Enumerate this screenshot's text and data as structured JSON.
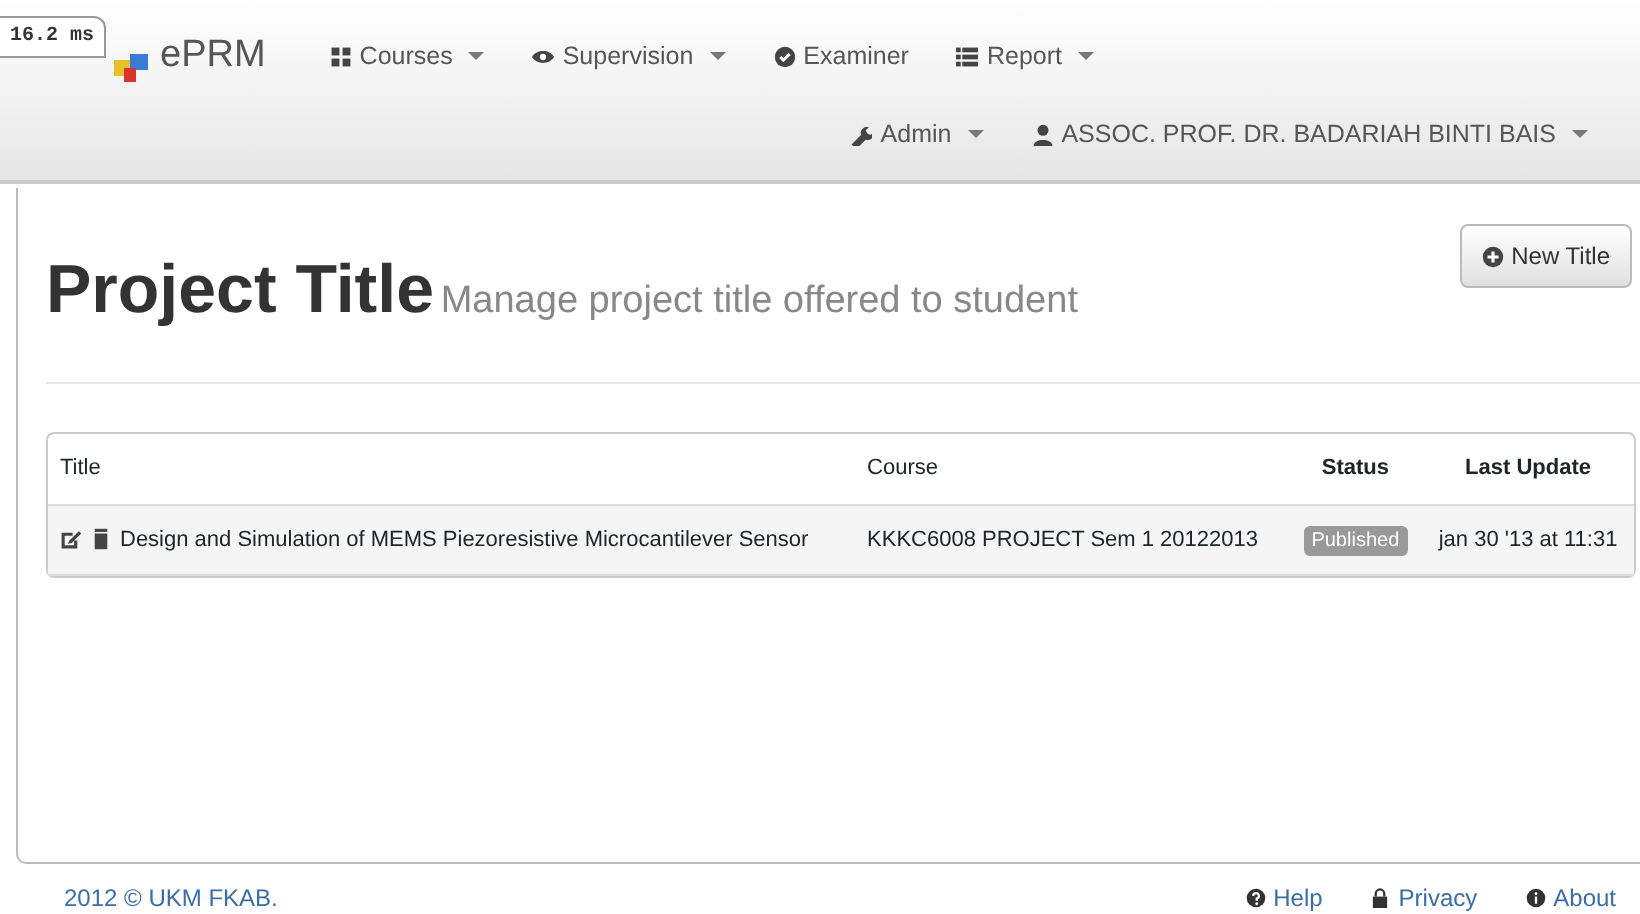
{
  "profiler_badge": "16.2 ms",
  "brand": "ePRM",
  "nav_items": [
    {
      "label": "Courses",
      "dropdown": true
    },
    {
      "label": "Supervision",
      "dropdown": true
    },
    {
      "label": "Examiner",
      "dropdown": false
    },
    {
      "label": "Report",
      "dropdown": true
    }
  ],
  "user_menu": [
    {
      "label": "Admin",
      "dropdown": true
    },
    {
      "label": "ASSOC. PROF. DR. BADARIAH BINTI BAIS",
      "dropdown": true
    }
  ],
  "page": {
    "title": "Project Title",
    "subtitle": "Manage project title offered to student",
    "new_button": "New Title"
  },
  "table": {
    "columns": [
      "Title",
      "Course",
      "Status",
      "Last Update"
    ],
    "rows": [
      {
        "title": "Design and Simulation of MEMS Piezoresistive Microcantilever Sensor",
        "course": "KKKC6008 PROJECT Sem 1 20122013",
        "status": "Published",
        "last_update": "jan 30 '13 at 11:31"
      }
    ]
  },
  "footer": {
    "copyright": "2012 © UKM FKAB.",
    "links": [
      {
        "label": "Help"
      },
      {
        "label": "Privacy"
      },
      {
        "label": "About"
      }
    ]
  }
}
